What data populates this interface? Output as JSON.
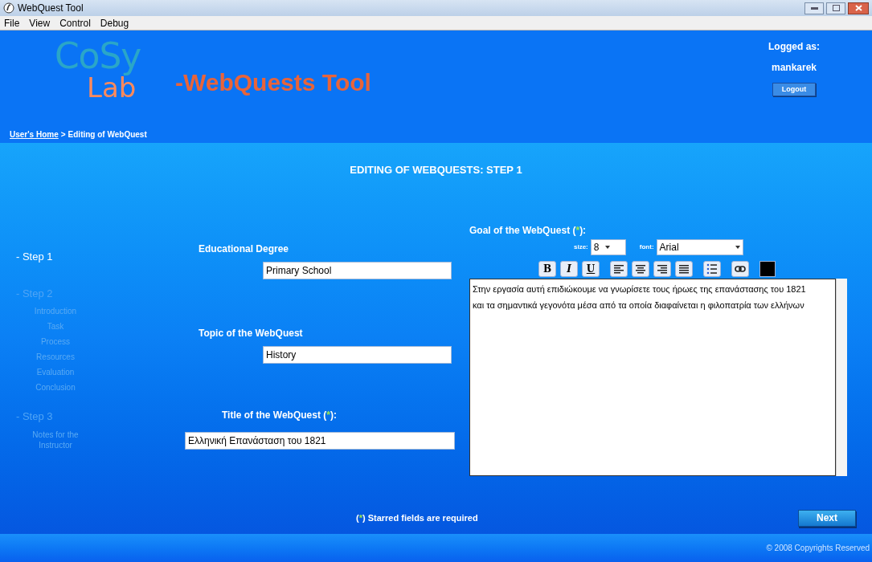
{
  "window": {
    "title": "WebQuest Tool"
  },
  "menu": [
    "File",
    "View",
    "Control",
    "Debug"
  ],
  "header": {
    "logo": {
      "top": "CoSy",
      "bottom": "Lab"
    },
    "app_name": "-WebQuests Tool",
    "logged_label": "Logged as:",
    "user": "mankarek",
    "logout": "Logout"
  },
  "breadcrumb": {
    "link": "User's Home",
    "separator": ">",
    "current": "Editing of WebQuest"
  },
  "page_title": "EDITING OF WEBQUESTS: STEP 1",
  "sidebar": [
    {
      "label": "- Step 1",
      "selected": true
    },
    {
      "label": "- Step 2",
      "selected": false,
      "children": [
        {
          "label": "Introduction",
          "selected": false
        },
        {
          "label": "Task",
          "selected": false
        },
        {
          "label": "Process",
          "selected": false
        },
        {
          "label": "Resources",
          "selected": false
        },
        {
          "label": "Evaluation",
          "selected": false
        },
        {
          "label": "Conclusion",
          "selected": false
        }
      ]
    },
    {
      "label": "- Step 3",
      "selected": false,
      "children": [
        {
          "label": "Notes for the Instructor",
          "selected": false
        }
      ]
    }
  ],
  "fields": [
    {
      "label": "Educational Degree",
      "value": "Primary School"
    },
    {
      "label": "Topic of the WebQuest",
      "value": "History"
    },
    {
      "label": "Title of the WebQuest (",
      "star": "*",
      "label_end": "):",
      "value": "Ελληνική Επανάσταση του 1821"
    }
  ],
  "goal": {
    "label": "Goal of the WebQuest (",
    "star": "*",
    "label_end": "):",
    "size_label": "size:",
    "size": "8",
    "font_label": "font:",
    "font": "Arial",
    "format_buttons": [
      {
        "kind": "bold",
        "text": "B"
      },
      {
        "kind": "italic",
        "text": "I"
      },
      {
        "kind": "underline",
        "text": "U"
      },
      {
        "kind": "align-left"
      },
      {
        "kind": "align-center"
      },
      {
        "kind": "align-right"
      },
      {
        "kind": "justify"
      },
      {
        "kind": "list"
      },
      {
        "kind": "link"
      },
      {
        "kind": "color",
        "color": "#000000"
      }
    ],
    "text": "Στην εργασία αυτή επιδιώκουμε να γνωρίσετε  τους ήρωες της επανάστασης του 1821 και τα σημαντικά γεγονότα μέσα από τα οποία διαφαίνεται η φιλοπατρία των ελλήνων"
  },
  "required_note": {
    "open": "(",
    "star": "*",
    "text": ") Starred fields are required"
  },
  "next": "Next",
  "footer": "© 2008 Copyrights Reserved"
}
